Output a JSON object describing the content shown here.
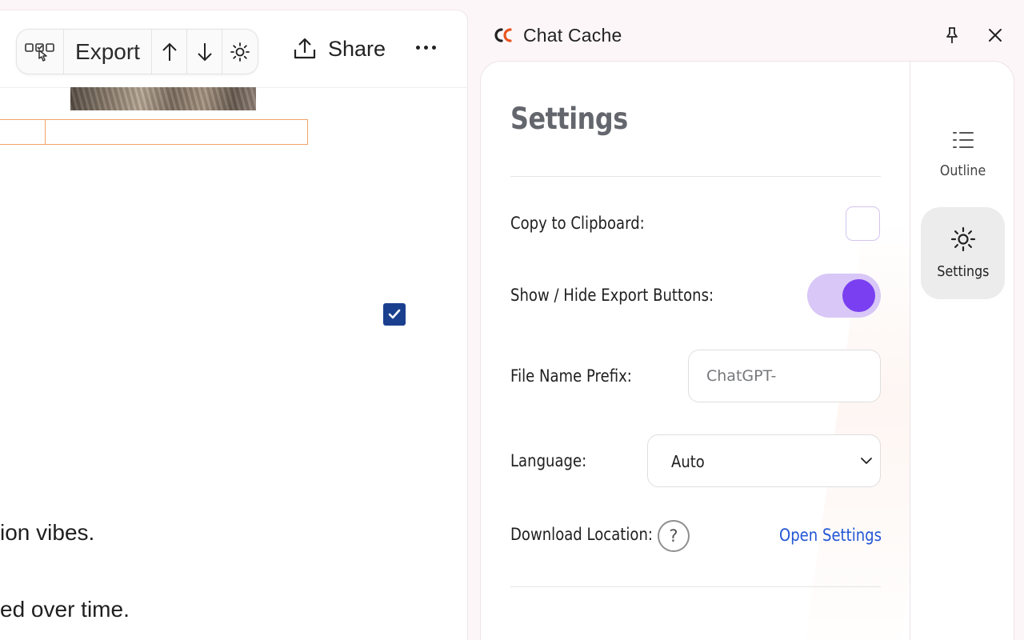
{
  "chat": {
    "toolbar": {
      "export_label": "Export"
    },
    "share_label": "Share",
    "text_line_1": "ion vibes.",
    "text_line_2": "ed over time."
  },
  "extension": {
    "title": "Chat Cache",
    "settings": {
      "heading": "Settings",
      "copy_to_clipboard_label": "Copy to Clipboard:",
      "copy_to_clipboard_checked": false,
      "show_hide_export_label": "Show / Hide Export Buttons:",
      "show_hide_export_on": true,
      "file_name_prefix_label": "File Name Prefix:",
      "file_name_prefix_value": "ChatGPT-",
      "language_label": "Language:",
      "language_value": "Auto",
      "download_location_label": "Download Location:",
      "help_glyph": "?",
      "open_settings_link": "Open Settings"
    },
    "nav": [
      {
        "label": "Outline",
        "icon": "outline-list-icon",
        "active": false
      },
      {
        "label": "Settings",
        "icon": "gear-icon",
        "active": true
      }
    ]
  },
  "colors": {
    "accent_purple": "#7a3ff0",
    "toggle_track": "#d8c7f7",
    "link_blue": "#2356d6",
    "checkbox_blue": "#1a3f8f",
    "highlight_orange": "#f0a36a"
  }
}
